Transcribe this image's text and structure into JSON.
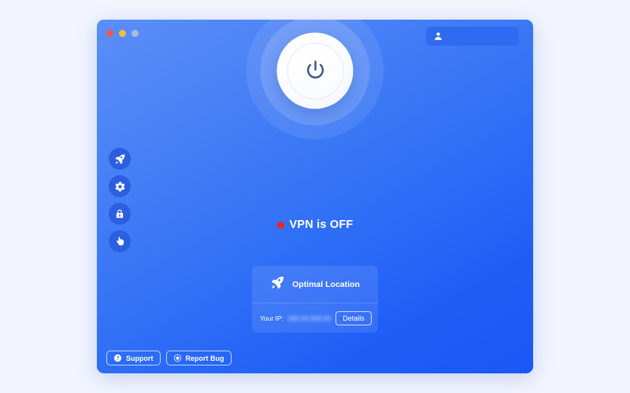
{
  "window": {
    "traffic_lights": [
      {
        "name": "close",
        "color": "#f2564f"
      },
      {
        "name": "minimize",
        "color": "#f3bd3f"
      },
      {
        "name": "maximize",
        "color": "#aebbd0"
      }
    ]
  },
  "account": {
    "icon": "person-icon",
    "name": "",
    "redacted": true
  },
  "sidebar": {
    "items": [
      {
        "icon": "rocket-icon",
        "name": "quick-connect"
      },
      {
        "icon": "gear-icon",
        "name": "settings"
      },
      {
        "icon": "lock-icon",
        "name": "security"
      },
      {
        "icon": "hand-icon",
        "name": "block"
      }
    ]
  },
  "power": {
    "icon": "power-icon",
    "state": "off"
  },
  "status": {
    "text": "VPN is OFF",
    "dot_color": "#f4231f"
  },
  "location_card": {
    "icon": "rocket-icon",
    "label": "Optimal Location",
    "ip_label": "Your IP:",
    "ip_value": "",
    "ip_redacted": true,
    "details_label": "Details"
  },
  "footer": {
    "buttons": [
      {
        "icon": "question-circle-icon",
        "label": "Support"
      },
      {
        "icon": "bug-circle-icon",
        "label": "Report Bug"
      }
    ]
  },
  "colors": {
    "page_background": "#f2f5fe",
    "window_gradient_start": "#5b8ef7",
    "window_gradient_end": "#1a57f5",
    "accent_badge": "#2f6bf0",
    "sidebar_button": "#2b5fe0",
    "status_red": "#f4231f",
    "power_glyph": "#3d5282"
  }
}
